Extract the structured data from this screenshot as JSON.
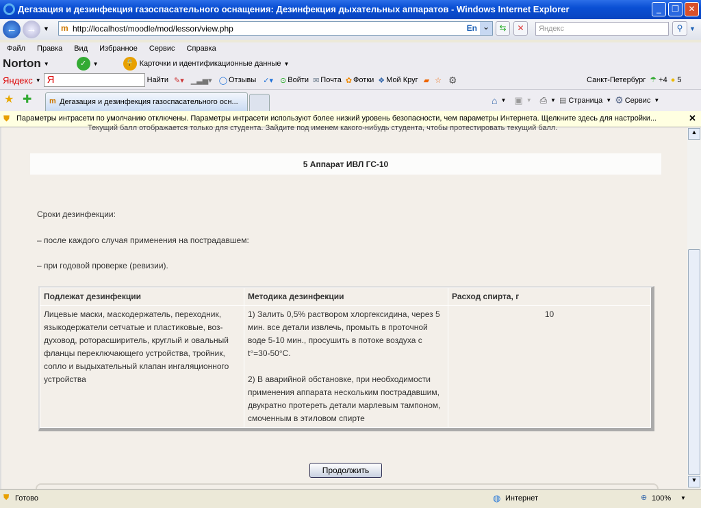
{
  "window": {
    "title": "Дегазация и дезинфекция газоспасательного оснащения: Дезинфекция дыхательных аппаратов - Windows Internet Explorer"
  },
  "address": {
    "url": "http://localhost/moodle/mod/lesson/view.php",
    "lang": "En",
    "search_placeholder": "Яндекс"
  },
  "menu": [
    "Файл",
    "Правка",
    "Вид",
    "Избранное",
    "Сервис",
    "Справка"
  ],
  "norton": {
    "logo": "Norton",
    "cards": "Карточки и идентификационные данные"
  },
  "yandex": {
    "logo": "Яндекс",
    "find": "Найти",
    "reviews": "Отзывы",
    "login": "Войти",
    "mail": "Почта",
    "photos": "Фотки",
    "circle": "Мой Круг",
    "city": "Санкт-Петербург",
    "temp": "+4",
    "traffic": "5"
  },
  "tab": {
    "title": "Дегазация и дезинфекция газоспасательного осн..."
  },
  "commandbar": {
    "page": "Страница",
    "tools": "Сервис"
  },
  "infobar": {
    "text": "Параметры интрасети по умолчанию отключены. Параметры интрасети используют более низкий уровень безопасности, чем параметры Интернета. Щелкните здесь для настройки..."
  },
  "page": {
    "notice": "Текущий балл отображается только для студента. Зайдите под именем какого-нибудь студента, чтобы протестировать текущий балл.",
    "heading": "5 Аппарат ИВЛ ГС-10",
    "p1": "Сроки дезинфекции:",
    "p2": "– после каждого случая применения на пострадавшем:",
    "p3": "– при годовой проверке (ревизии).",
    "table": {
      "headers": [
        "Подлежат дезинфекции",
        "Методика дезинфекции",
        "Расход спирта, г"
      ],
      "row": {
        "items": "Лицевые маски, маскодержатель, переходник, языкодержатели сетчатые и пластиковые, воз-духовод, роторасширитель, круглый и овальный фланцы переключающего устройства, тройник, сопло и выдыхательный клапан ингаляционного устройства",
        "method1": "1) Залить 0,5% раствором хлоргексидина, через 5 мин. все детали извлечь, промыть в проточной воде 5-10 мин., просушить в потоке воздуха с t°=30-50°C.",
        "method2": "2) В аварийной обстановке, при необходимости применения аппарата нескольким пострадавшим, двукратно протереть детали марлевым тампоном, смоченным в этиловом спирте",
        "amount": "10"
      }
    },
    "continue": "Продолжить"
  },
  "status": {
    "text": "Готово",
    "zone": "Интернет",
    "zoom": "100%"
  }
}
